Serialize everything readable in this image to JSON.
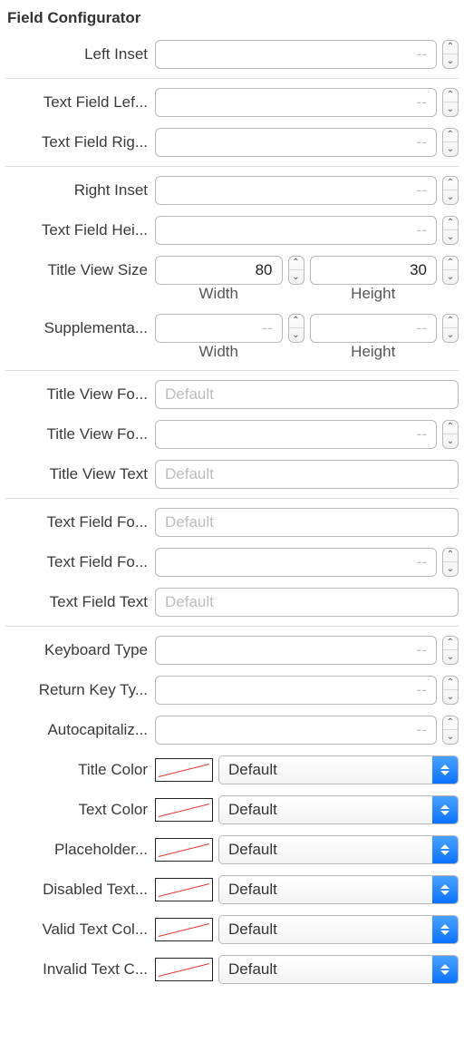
{
  "section": {
    "title": "Field Configurator"
  },
  "placeholders": {
    "dash": "--",
    "default": "Default"
  },
  "rows": {
    "leftInset": {
      "label": "Left Inset",
      "value": ""
    },
    "textFieldLeft": {
      "label": "Text Field Lef...",
      "value": ""
    },
    "textFieldRight": {
      "label": "Text Field Rig...",
      "value": ""
    },
    "rightInset": {
      "label": "Right Inset",
      "value": ""
    },
    "textFieldHeight": {
      "label": "Text Field Hei...",
      "value": ""
    },
    "titleViewSize": {
      "label": "Title View Size",
      "width": "80",
      "height": "30",
      "widthCaption": "Width",
      "heightCaption": "Height"
    },
    "supplementarySize": {
      "label": "Supplementa...",
      "width": "",
      "height": "",
      "widthCaption": "Width",
      "heightCaption": "Height"
    },
    "titleViewFontName": {
      "label": "Title View Fo...",
      "value": ""
    },
    "titleViewFontSize": {
      "label": "Title View Fo...",
      "value": ""
    },
    "titleViewText": {
      "label": "Title View Text",
      "value": ""
    },
    "textFieldFontName": {
      "label": "Text Field Fo...",
      "value": ""
    },
    "textFieldFontSize": {
      "label": "Text Field Fo...",
      "value": ""
    },
    "textFieldText": {
      "label": "Text Field Text",
      "value": ""
    },
    "keyboardType": {
      "label": "Keyboard Type",
      "value": ""
    },
    "returnKeyType": {
      "label": "Return Key Ty...",
      "value": ""
    },
    "autocapitalization": {
      "label": "Autocapitaliz...",
      "value": ""
    },
    "titleColor": {
      "label": "Title Color",
      "popup": "Default"
    },
    "textColor": {
      "label": "Text Color",
      "popup": "Default"
    },
    "placeholderColor": {
      "label": "Placeholder...",
      "popup": "Default"
    },
    "disabledTextColor": {
      "label": "Disabled Text...",
      "popup": "Default"
    },
    "validTextColor": {
      "label": "Valid Text Col...",
      "popup": "Default"
    },
    "invalidTextColor": {
      "label": "Invalid Text C...",
      "popup": "Default"
    }
  }
}
